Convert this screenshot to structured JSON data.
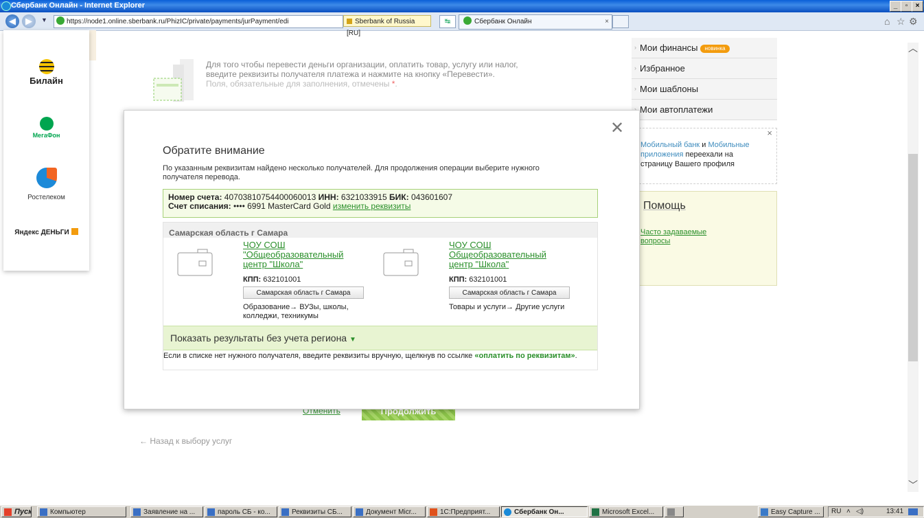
{
  "window": {
    "title": "Сбербанк Онлайн - Internet Explorer"
  },
  "browser": {
    "url": "https://node1.online.sberbank.ru/PhizIC/private/payments/jurPayment/edi",
    "cert_label": "Sberbank of Russia [RU]",
    "tab_title": "Сбербанк Онлайн"
  },
  "operators": [
    {
      "name": "Билайн",
      "color": "#f6c400"
    },
    {
      "name": "МегаФон",
      "color": "#00a54f"
    },
    {
      "name": "Ростелеком",
      "color": "#1d8ad8"
    },
    {
      "name": "Яндекс ДЕНЬГИ",
      "color": "#f39c0e"
    }
  ],
  "intro": {
    "line1": "Для того чтобы перевести деньги организации, оплатить товар, услугу или налог,",
    "line2": "введите реквизиты получателя платежа и нажмите на кнопку «Перевести».",
    "line3": "Поля, обязательные для заполнения, отмечены",
    "req_mark": "*"
  },
  "right_menu": {
    "items": [
      "Мои финансы",
      "Избранное",
      "Мои шаблоны",
      "Мои автоплатежи"
    ],
    "badge": "новинка"
  },
  "notice": {
    "link1": "Мобильный банк",
    "and": "и",
    "link2": "Мобильные приложения",
    "rest": "переехали на страницу Вашего профиля"
  },
  "help": {
    "title": "Помощь",
    "faq": "Часто задаваемые вопросы"
  },
  "background_buttons": {
    "cancel": "Отменить",
    "continue": "Продолжить"
  },
  "back_link": "← Назад к выбору услуг",
  "modal": {
    "title": "Обратите внимание",
    "description": "По указанным реквизитам найдено несколько получателей. Для продолжения операции выберите нужного получателя перевода.",
    "account_label": "Номер счета:",
    "account": "40703810754400060013",
    "inn_label": "ИНН:",
    "inn": "6321033915",
    "bik_label": "БИК:",
    "bik": "043601607",
    "debit_label": "Счет списания:",
    "debit": "•••• 6991 MasterCard Gold",
    "change_link": "изменить реквизиты",
    "region_header": "Самарская область г Самара",
    "recipients": [
      {
        "name": "ЧОУ СОШ \"Общеобразовательный центр \"Школа\"",
        "kpp_label": "КПП:",
        "kpp": "632101001",
        "region_button": "Самарская область г Самара",
        "category": "Образование→ ВУЗы, школы, колледжи, техникумы"
      },
      {
        "name": "ЧОУ СОШ Общеобразовательный центр \"Школа\"",
        "kpp_label": "КПП:",
        "kpp": "632101001",
        "region_button": "Самарская область г Самара",
        "category": "Товары и услуги→ Другие услуги"
      }
    ],
    "show_all": "Показать результаты без учета региона",
    "footer_text": "Если в списке нет нужного получателя, введите реквизиты вручную, щелкнув по ссылке",
    "footer_link": "«оплатить по реквизитам»",
    "footer_end": "."
  },
  "taskbar": {
    "start": "Пуск",
    "items": [
      "Компьютер",
      "Заявление на ...",
      "пароль СБ - ко...",
      "Реквизиты СБ...",
      "Документ Micr...",
      "1С:Предприят...",
      "Сбербанк Он...",
      "Microsoft Excel...",
      "",
      "Easy Capture ..."
    ],
    "lang": "RU",
    "time": "13:41"
  }
}
